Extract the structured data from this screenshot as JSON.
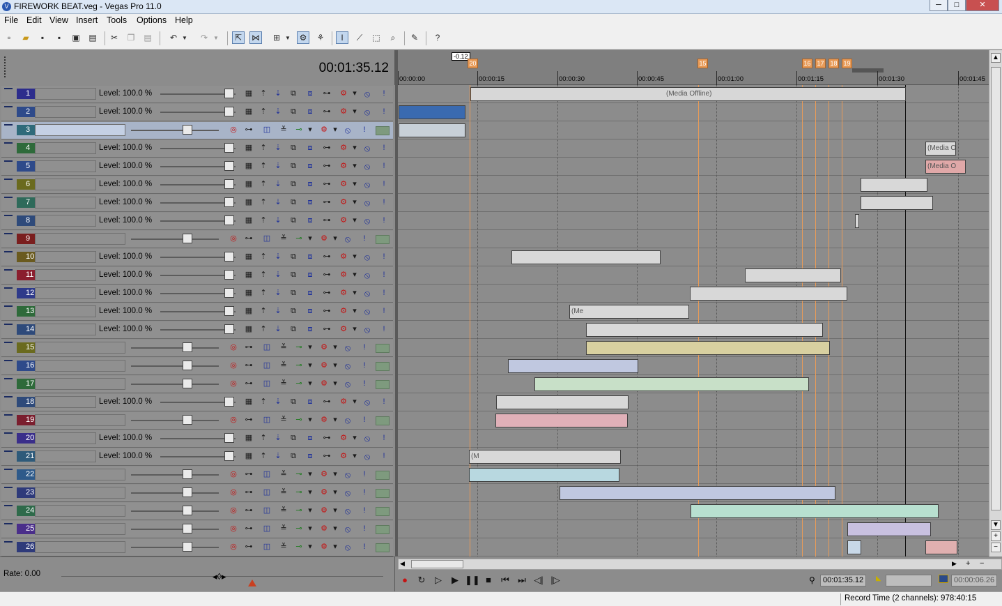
{
  "window": {
    "title": "FIREWORK BEAT.veg - Vegas Pro 11.0",
    "minimize": "─",
    "maximize": "□",
    "close": "✕"
  },
  "menu": [
    "File",
    "Edit",
    "View",
    "Insert",
    "Tools",
    "Options",
    "Help"
  ],
  "header": {
    "timecode": "00:01:35.12"
  },
  "tracks": [
    {
      "n": "1",
      "type": "video",
      "color": "#2c2c8c",
      "level": "Level: 100.0 %"
    },
    {
      "n": "2",
      "type": "video",
      "color": "#2e4a8a",
      "level": "Level: 100.0 %"
    },
    {
      "n": "3",
      "type": "audio",
      "color": "#2e6a7a",
      "selected": true
    },
    {
      "n": "4",
      "type": "video",
      "color": "#2e6a3a",
      "level": "Level: 100.0 %"
    },
    {
      "n": "5",
      "type": "video",
      "color": "#2e4a8a",
      "level": "Level: 100.0 %"
    },
    {
      "n": "6",
      "type": "video",
      "color": "#6a6a1e",
      "level": "Level: 100.0 %"
    },
    {
      "n": "7",
      "type": "video",
      "color": "#2e6a5a",
      "level": "Level: 100.0 %"
    },
    {
      "n": "8",
      "type": "video",
      "color": "#2e4a7a",
      "level": "Level: 100.0 %"
    },
    {
      "n": "9",
      "type": "audio",
      "color": "#7a1e1e"
    },
    {
      "n": "10",
      "type": "video",
      "color": "#6a5a1e",
      "level": "Level: 100.0 %"
    },
    {
      "n": "11",
      "type": "video",
      "color": "#8a1e2e",
      "level": "Level: 100.0 %"
    },
    {
      "n": "12",
      "type": "video",
      "color": "#2e3a8a",
      "level": "Level: 100.0 %"
    },
    {
      "n": "13",
      "type": "video",
      "color": "#2e6a3a",
      "level": "Level: 100.0 %"
    },
    {
      "n": "14",
      "type": "video",
      "color": "#2e4a7a",
      "level": "Level: 100.0 %"
    },
    {
      "n": "15",
      "type": "audio",
      "color": "#6a6a1e"
    },
    {
      "n": "16",
      "type": "audio",
      "color": "#2e4a8a"
    },
    {
      "n": "17",
      "type": "audio",
      "color": "#2e6a3a"
    },
    {
      "n": "18",
      "type": "video",
      "color": "#2e4a7a",
      "level": "Level: 100.0 %"
    },
    {
      "n": "19",
      "type": "audio",
      "color": "#7a1e2e"
    },
    {
      "n": "20",
      "type": "video",
      "color": "#3a2e8a",
      "level": "Level: 100.0 %"
    },
    {
      "n": "21",
      "type": "video",
      "color": "#2e5a7a",
      "level": "Level: 100.0 %"
    },
    {
      "n": "22",
      "type": "audio",
      "color": "#2e5a8a"
    },
    {
      "n": "23",
      "type": "audio",
      "color": "#2e3a7a"
    },
    {
      "n": "24",
      "type": "audio",
      "color": "#2e6a4a"
    },
    {
      "n": "25",
      "type": "audio",
      "color": "#4a2e8a"
    },
    {
      "n": "26",
      "type": "audio",
      "color": "#2e3a7a"
    }
  ],
  "ruler": {
    "offset_label": "-0.12",
    "ticks": [
      "00:00:00",
      "00:00:15",
      "00:00:30",
      "00:00:45",
      "00:01:00",
      "00:01:15",
      "00:01:30",
      "00:01:45"
    ],
    "markers": [
      "20",
      "15",
      "16",
      "17",
      "18",
      "19"
    ]
  },
  "events": [
    {
      "lane": 0,
      "label": "(Media Offline)"
    },
    {
      "lane": 11,
      "label": "(M"
    },
    {
      "lane": 4,
      "label": "(Media O"
    },
    {
      "lane": 3,
      "label": "(Media O"
    },
    {
      "lane": 12,
      "label": "(Me"
    }
  ],
  "bottom": {
    "rate": "Rate: 0.00",
    "rate_handle": "◂◊▸"
  },
  "transport": {
    "record": "●",
    "loop": "↻",
    "play_from_start": "▷",
    "play": "▶",
    "pause": "❚❚",
    "stop": "■",
    "go_start": "⏮",
    "go_end": "⏭",
    "prev_frame": "◁|",
    "next_frame": "|▷",
    "cursor_time": "00:01:35.12",
    "selection_length": "",
    "end_time": "00:00:06.26"
  },
  "status": {
    "record_time": "Record Time (2 channels): 978:40:15"
  },
  "colors": {
    "marker": "#e89b58",
    "selected_track": "#a8b4c8",
    "background": "#8c8c8c"
  }
}
